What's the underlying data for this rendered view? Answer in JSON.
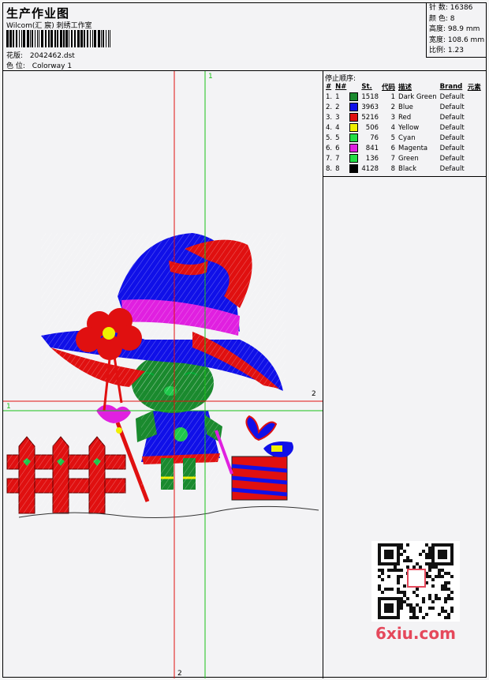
{
  "header": {
    "title": "生产作业图",
    "studio": "Wilcom(汇 宸) 刺绣工作室",
    "pattern_label": "花版:",
    "pattern_value": "2042462.dst",
    "colorway_label": "色 位:",
    "colorway_value": "Colorway 1"
  },
  "stats": [
    {
      "label": "针 数:",
      "value": "16386"
    },
    {
      "label": "颜 色:",
      "value": "8"
    },
    {
      "label": "高度:",
      "value": "98.9 mm"
    },
    {
      "label": "宽度:",
      "value": "108.6 mm"
    },
    {
      "label": "比例:",
      "value": "1.23"
    }
  ],
  "stop_sequence": {
    "title": "停止顺序:",
    "headers": [
      "#",
      "N#",
      "St.",
      "代码",
      "描述",
      "Brand",
      "元素"
    ],
    "rows": [
      {
        "idx": "1.",
        "n": "1",
        "color": "#1a8a2e",
        "st": "1518",
        "code": "1",
        "desc": "Dark Green",
        "brand": "Default"
      },
      {
        "idx": "2.",
        "n": "2",
        "color": "#1010e8",
        "st": "3963",
        "code": "2",
        "desc": "Blue",
        "brand": "Default"
      },
      {
        "idx": "3.",
        "n": "3",
        "color": "#e01010",
        "st": "5216",
        "code": "3",
        "desc": "Red",
        "brand": "Default"
      },
      {
        "idx": "4.",
        "n": "4",
        "color": "#f0f000",
        "st": "506",
        "code": "4",
        "desc": "Yellow",
        "brand": "Default"
      },
      {
        "idx": "5.",
        "n": "5",
        "color": "#22dd44",
        "st": "76",
        "code": "5",
        "desc": "Cyan",
        "brand": "Default"
      },
      {
        "idx": "6.",
        "n": "6",
        "color": "#e020e0",
        "st": "841",
        "code": "6",
        "desc": "Magenta",
        "brand": "Default"
      },
      {
        "idx": "7.",
        "n": "7",
        "color": "#22dd44",
        "st": "136",
        "code": "7",
        "desc": "Green",
        "brand": "Default"
      },
      {
        "idx": "8.",
        "n": "8",
        "color": "#000000",
        "st": "4128",
        "code": "8",
        "desc": "Black",
        "brand": "Default"
      }
    ]
  },
  "guides": {
    "vertical_top": "1",
    "vertical_bottom": "2",
    "horizontal_left": "1",
    "horizontal_right": "2"
  },
  "watermark": "6xiu.com",
  "colors": {
    "guide_red": "#e01010",
    "guide_green": "#18c018",
    "watermark": "#e5485b"
  }
}
